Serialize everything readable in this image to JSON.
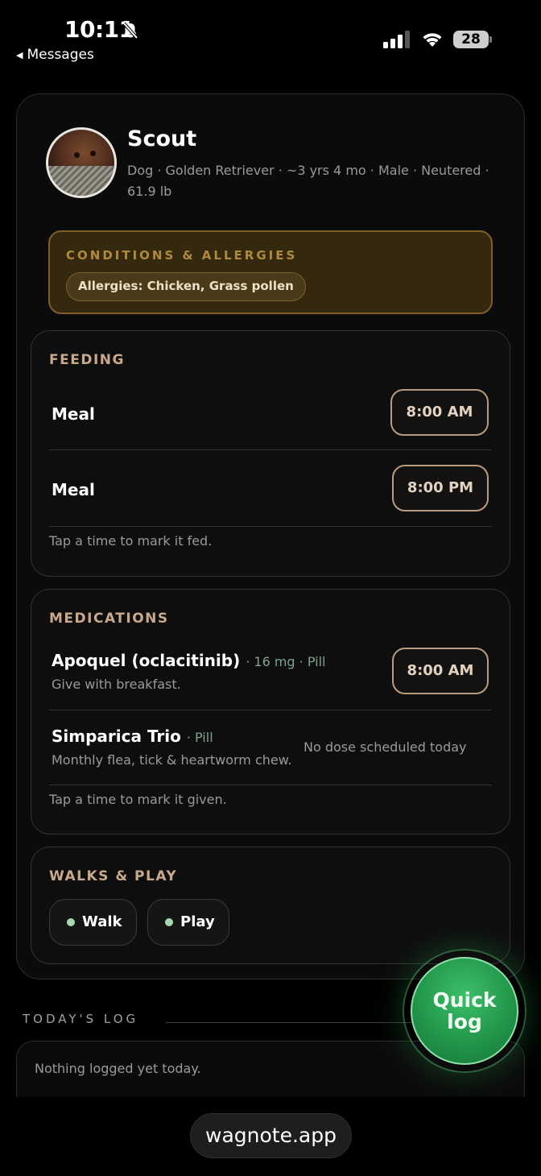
{
  "status_bar": {
    "time": "10:11",
    "back_label": "Messages",
    "battery": "28"
  },
  "pet": {
    "name": "Scout",
    "meta_line1": "Dog · Golden Retriever · ~3 yrs 4 mo · Male · Neutered ·",
    "meta_line2": "61.9 lb"
  },
  "conditions": {
    "title": "CONDITIONS & ALLERGIES",
    "chips": [
      "Allergies: Chicken, Grass pollen"
    ]
  },
  "feeding": {
    "title": "FEEDING",
    "rows": [
      {
        "label": "Meal",
        "time": "8:00 AM"
      },
      {
        "label": "Meal",
        "time": "8:00 PM"
      }
    ],
    "hint": "Tap a time to mark it fed."
  },
  "medications": {
    "title": "MEDICATIONS",
    "rows": [
      {
        "name": "Apoquel (oclacitinib)",
        "meta": "· 16 mg · Pill",
        "note": "Give with breakfast.",
        "time": "8:00 AM"
      },
      {
        "name": "Simparica Trio",
        "meta": "· Pill",
        "note": "Monthly flea, tick & heartworm chew.",
        "status": "No dose scheduled today"
      }
    ],
    "hint": "Tap a time to mark it given."
  },
  "walks": {
    "title": "WALKS & PLAY",
    "chips": [
      "Walk",
      "Play"
    ]
  },
  "todays_log": {
    "title": "TODAY'S LOG",
    "empty": "Nothing logged yet today."
  },
  "quick_log": {
    "label": "Quick log"
  },
  "browser": {
    "url": "wagnote.app"
  },
  "colors": {
    "accent_green": "#22964a",
    "allergy_border": "#7d5f27",
    "section_title": "#c9a98a"
  }
}
